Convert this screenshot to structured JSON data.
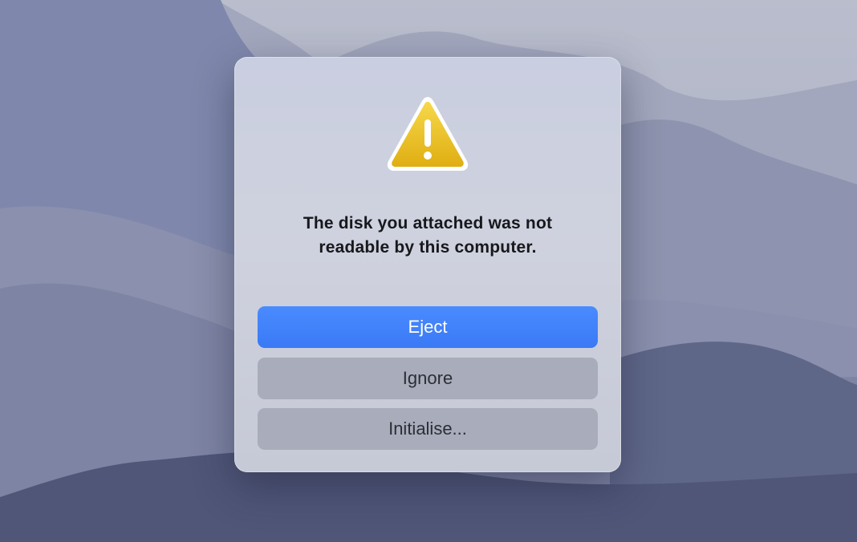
{
  "dialog": {
    "icon": "warning-triangle-icon",
    "message_line1": "The disk you attached was not",
    "message_line2": "readable by this computer.",
    "buttons": {
      "eject": "Eject",
      "ignore": "Ignore",
      "initialise": "Initialise..."
    }
  },
  "colors": {
    "primary_button": "#3a79f5",
    "secondary_button": "#a8acbb",
    "warning_yellow": "#e6b800"
  }
}
